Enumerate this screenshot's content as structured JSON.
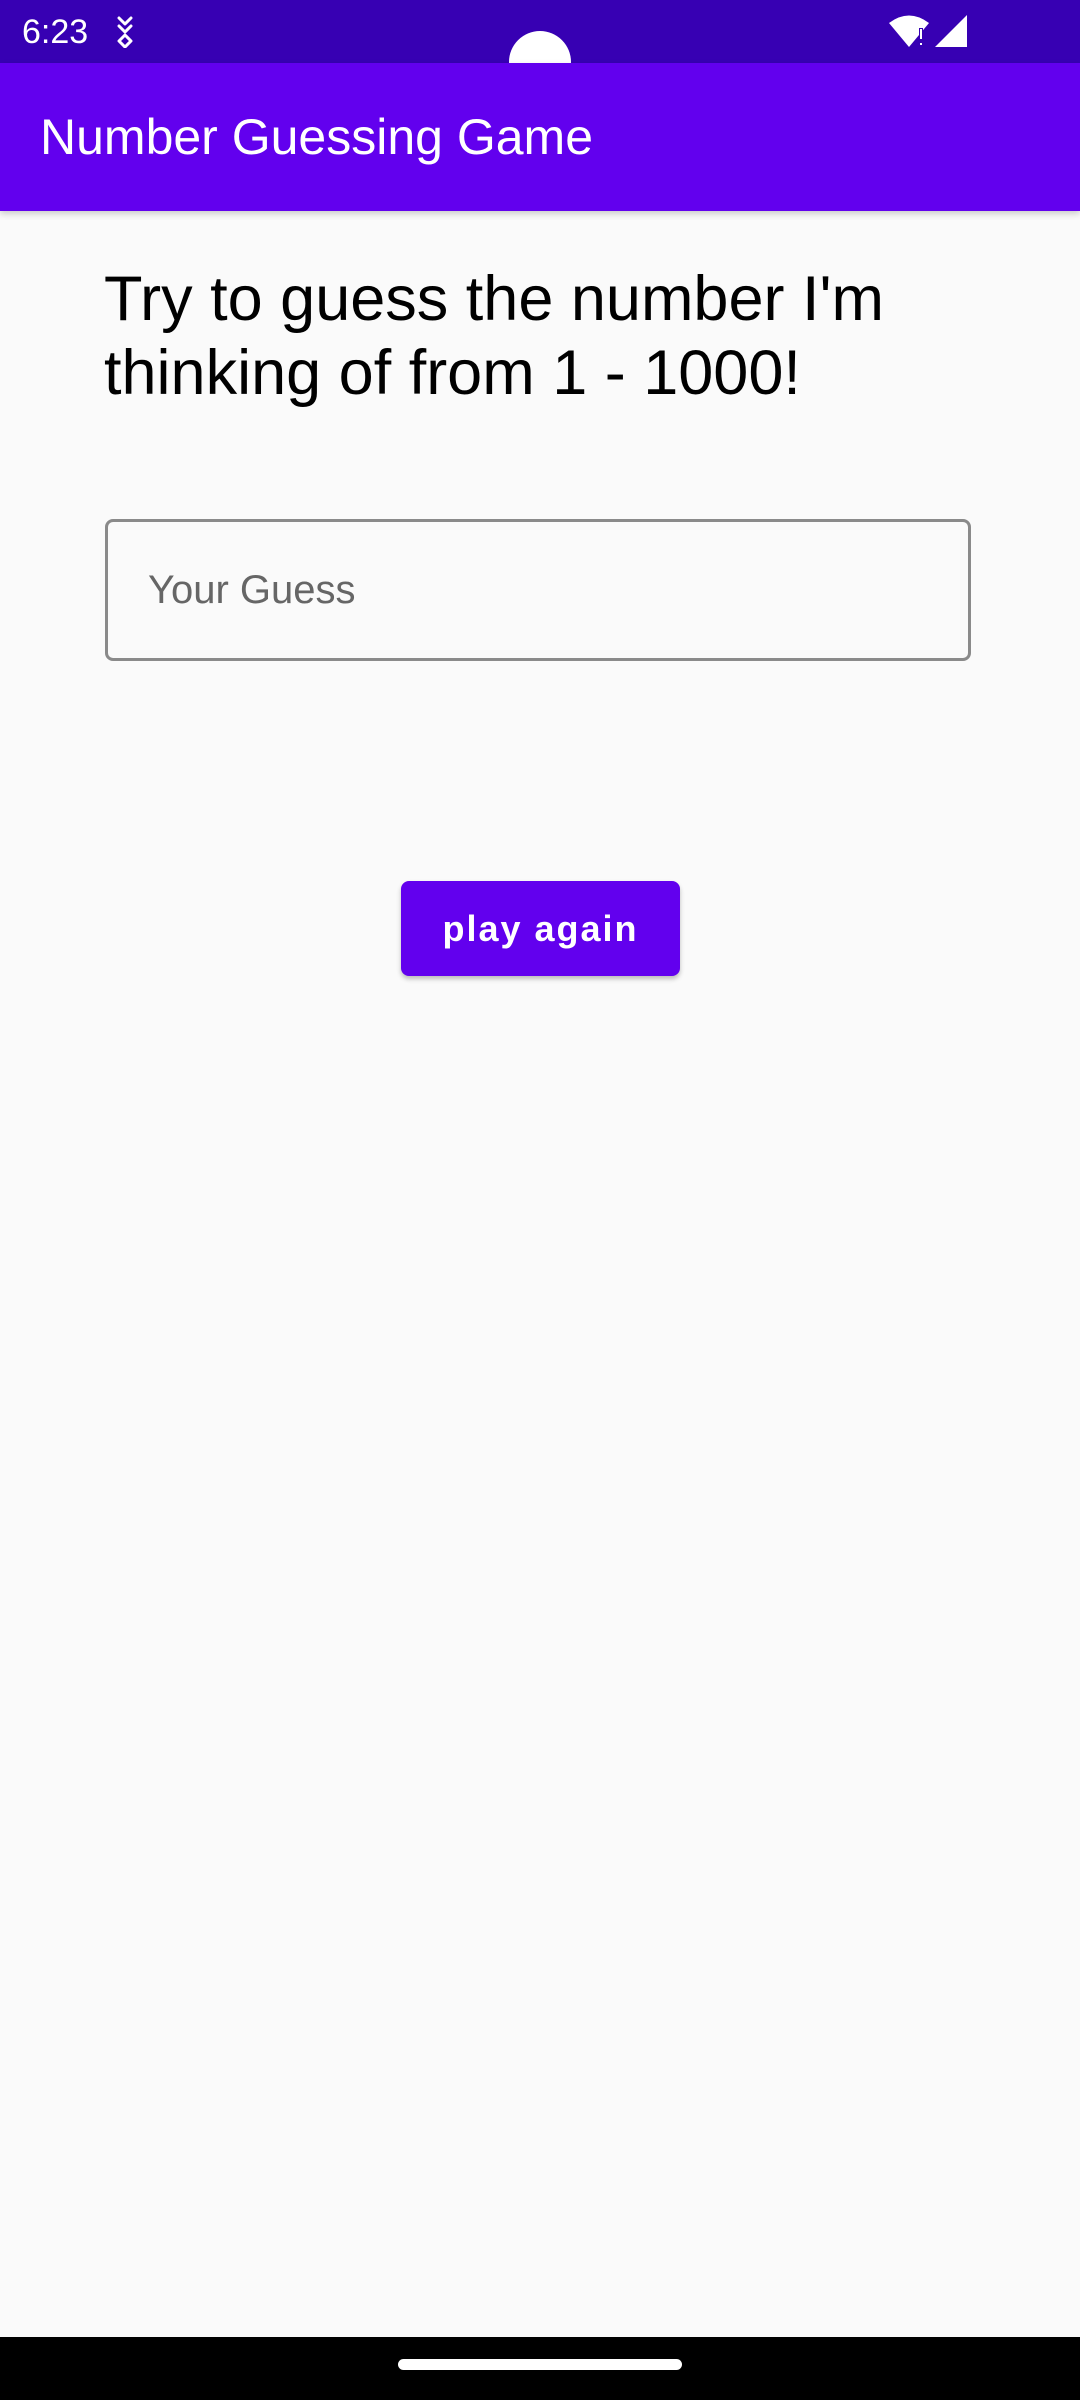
{
  "status_bar": {
    "time": "6:23",
    "notification_icon": "download-notification-icon",
    "wifi_icon": "wifi-alert-icon",
    "signal_icon": "cell-signal-icon",
    "color": "#3700b3"
  },
  "app_bar": {
    "title": "Number Guessing Game",
    "color": "#6200ee"
  },
  "main": {
    "prompt": "Try to guess the number I'm thinking of from 1 - 1000!",
    "guess_input": {
      "placeholder": "Your Guess",
      "value": ""
    },
    "play_again_label": "play again",
    "accent_color": "#6200ee"
  },
  "nav_bar": {
    "home_handle_icon": "home-gesture-handle"
  }
}
